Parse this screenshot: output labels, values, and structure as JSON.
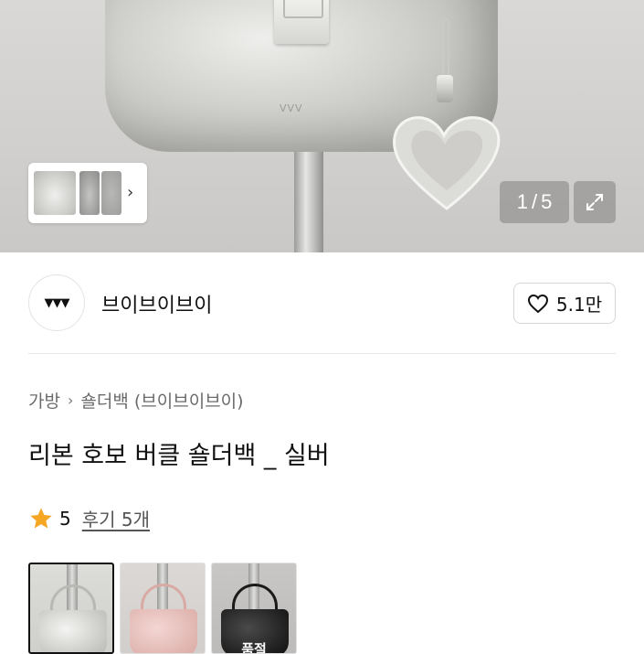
{
  "hero": {
    "bag_logo": "VVV",
    "counter": {
      "current": "1",
      "separator": "/",
      "total": "5"
    },
    "thumbnails": [
      "thumbnail-1",
      "thumbnail-2",
      "thumbnail-3"
    ],
    "chevron_icon": "chevron-right-icon",
    "expand_icon": "expand-icon"
  },
  "shop": {
    "logo_text": "▼▼▼",
    "name": "브이브이브이",
    "like_icon": "heart-icon",
    "like_count": "5.1만"
  },
  "breadcrumb": {
    "category": "가방",
    "separator_icon": "chevron-right-icon",
    "subcategory": "숄더백 (브이브이브이)"
  },
  "product": {
    "title": "리본 호보 버클 숄더백 _ 실버"
  },
  "rating": {
    "star_icon": "star-icon",
    "star_color": "#f5a623",
    "score": "5",
    "reviews_label": "후기 5개"
  },
  "color_options": [
    {
      "name": "silver",
      "selected": true,
      "badge": ""
    },
    {
      "name": "pink",
      "selected": false,
      "badge": ""
    },
    {
      "name": "black",
      "selected": false,
      "badge": "품절"
    }
  ]
}
